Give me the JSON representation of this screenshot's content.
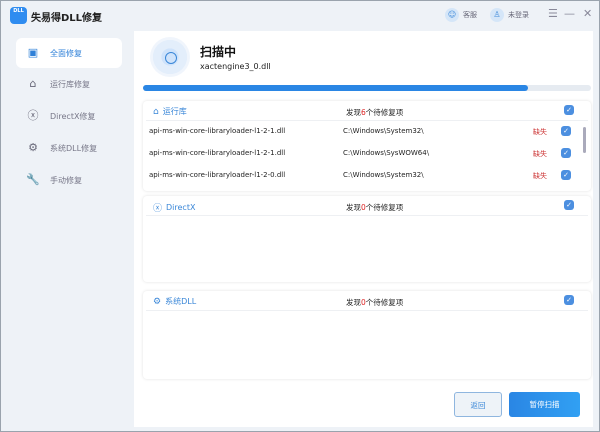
{
  "app": {
    "title": "失易得DLL修复",
    "logo_text": "DLL",
    "support": "客服",
    "login": "未登录"
  },
  "sidebar": {
    "items": [
      {
        "label": "全面修复",
        "icon": "pulse-monitor-icon"
      },
      {
        "label": "运行库修复",
        "icon": "library-icon"
      },
      {
        "label": "DirectX修复",
        "icon": "x-circle-icon"
      },
      {
        "label": "系统DLL修复",
        "icon": "gear-icon"
      },
      {
        "label": "手动修复",
        "icon": "wrench-icon"
      }
    ]
  },
  "scan": {
    "title": "扫描中",
    "file": "xactengine3_0.dll",
    "progress_percent": 86
  },
  "sections": [
    {
      "name": "运行库",
      "count_prefix": "发现",
      "count": "6",
      "count_suffix": "个待修复项",
      "rows": [
        {
          "file": "api-ms-win-core-libraryloader-l1-2-1.dll",
          "path": "C:\\Windows\\System32\\",
          "status": "缺失"
        },
        {
          "file": "api-ms-win-core-libraryloader-l1-2-1.dll",
          "path": "C:\\Windows\\SysWOW64\\",
          "status": "缺失"
        },
        {
          "file": "api-ms-win-core-libraryloader-l1-2-0.dll",
          "path": "C:\\Windows\\System32\\",
          "status": "缺失"
        }
      ]
    },
    {
      "name": "DirectX",
      "count_prefix": "发现",
      "count": "0",
      "count_suffix": "个待修复项"
    },
    {
      "name": "系统DLL",
      "count_prefix": "发现",
      "count": "0",
      "count_suffix": "个待修复项"
    }
  ],
  "buttons": {
    "back": "返回",
    "pause": "暂停扫描"
  }
}
